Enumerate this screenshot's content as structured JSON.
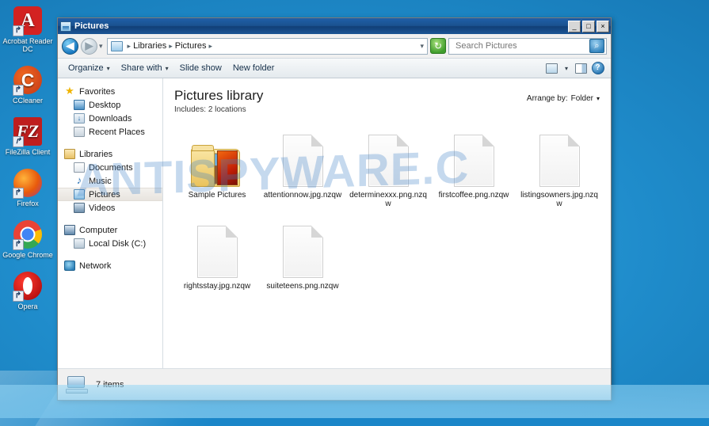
{
  "desktop": {
    "icons": [
      {
        "label": "Acrobat Reader DC",
        "icon": "acrobat-icon",
        "glyph": "⬢"
      },
      {
        "label": "CCleaner",
        "icon": "ccleaner-icon",
        "glyph": "C"
      },
      {
        "label": "FileZilla Client",
        "icon": "filezilla-icon",
        "glyph": "FZ"
      },
      {
        "label": "Firefox",
        "icon": "firefox-icon",
        "glyph": ""
      },
      {
        "label": "Google Chrome",
        "icon": "chrome-icon",
        "glyph": ""
      },
      {
        "label": "Opera",
        "icon": "opera-icon",
        "glyph": ""
      }
    ]
  },
  "window": {
    "title": "Pictures",
    "minimize_label": "_",
    "maximize_label": "□",
    "close_label": "×"
  },
  "address": {
    "back_label": "◀",
    "forward_label": "▶",
    "history_caret": "▾",
    "crumb_root": "Libraries",
    "crumb_current": "Pictures",
    "separator": "▸",
    "dropdown_caret": "▾",
    "refresh_label": "↻"
  },
  "search": {
    "placeholder": "Search Pictures",
    "value": "",
    "icon_glyph": "⌕"
  },
  "toolbar": {
    "organize": "Organize",
    "share_with": "Share with",
    "slide_show": "Slide show",
    "new_folder": "New folder",
    "caret": "▾",
    "help_glyph": "?"
  },
  "navpane": {
    "groups": [
      {
        "header": {
          "label": "Favorites",
          "icon": "star-icon"
        },
        "items": [
          {
            "label": "Desktop",
            "icon": "desktop-icon"
          },
          {
            "label": "Downloads",
            "icon": "downloads-icon"
          },
          {
            "label": "Recent Places",
            "icon": "recent-places-icon"
          }
        ]
      },
      {
        "header": {
          "label": "Libraries",
          "icon": "libraries-icon"
        },
        "items": [
          {
            "label": "Documents",
            "icon": "documents-icon"
          },
          {
            "label": "Music",
            "icon": "music-icon"
          },
          {
            "label": "Pictures",
            "icon": "pictures-icon",
            "selected": true
          },
          {
            "label": "Videos",
            "icon": "videos-icon"
          }
        ]
      },
      {
        "header": {
          "label": "Computer",
          "icon": "computer-icon"
        },
        "items": [
          {
            "label": "Local Disk (C:)",
            "icon": "local-disk-icon"
          }
        ]
      },
      {
        "header": {
          "label": "Network",
          "icon": "network-icon"
        },
        "items": []
      }
    ]
  },
  "library": {
    "title": "Pictures library",
    "includes_label": "Includes:",
    "includes_value": "2 locations",
    "arrange_label": "Arrange by:",
    "arrange_value": "Folder",
    "arrange_caret": "▾"
  },
  "items": [
    {
      "name": "Sample Pictures",
      "type": "folder"
    },
    {
      "name": "attentionnow.jpg.nzqw",
      "type": "file"
    },
    {
      "name": "determinexxx.png.nzqw",
      "type": "file"
    },
    {
      "name": "firstcoffee.png.nzqw",
      "type": "file"
    },
    {
      "name": "listingsowners.jpg.nzqw",
      "type": "file"
    },
    {
      "name": "rightsstay.jpg.nzqw",
      "type": "file"
    },
    {
      "name": "suiteteens.png.nzqw",
      "type": "file"
    }
  ],
  "status": {
    "text": "7 items",
    "icon": "computer-icon"
  },
  "watermark": {
    "text": "ANTISPYWARE.C"
  }
}
